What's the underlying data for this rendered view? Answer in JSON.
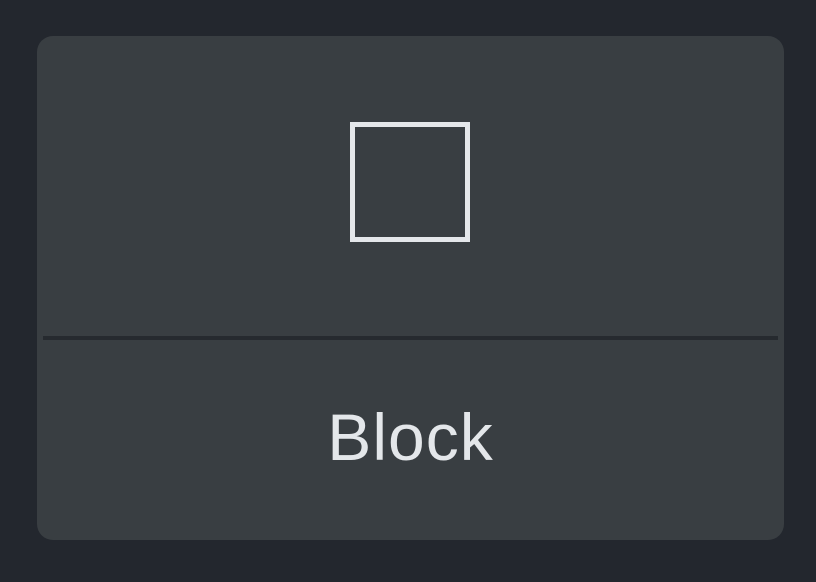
{
  "tile": {
    "icon": "square-outline-icon",
    "label": "Block"
  },
  "colors": {
    "background": "#23272e",
    "card": "#393e42",
    "divider": "#262a2f",
    "foreground": "#e4e7ea"
  }
}
